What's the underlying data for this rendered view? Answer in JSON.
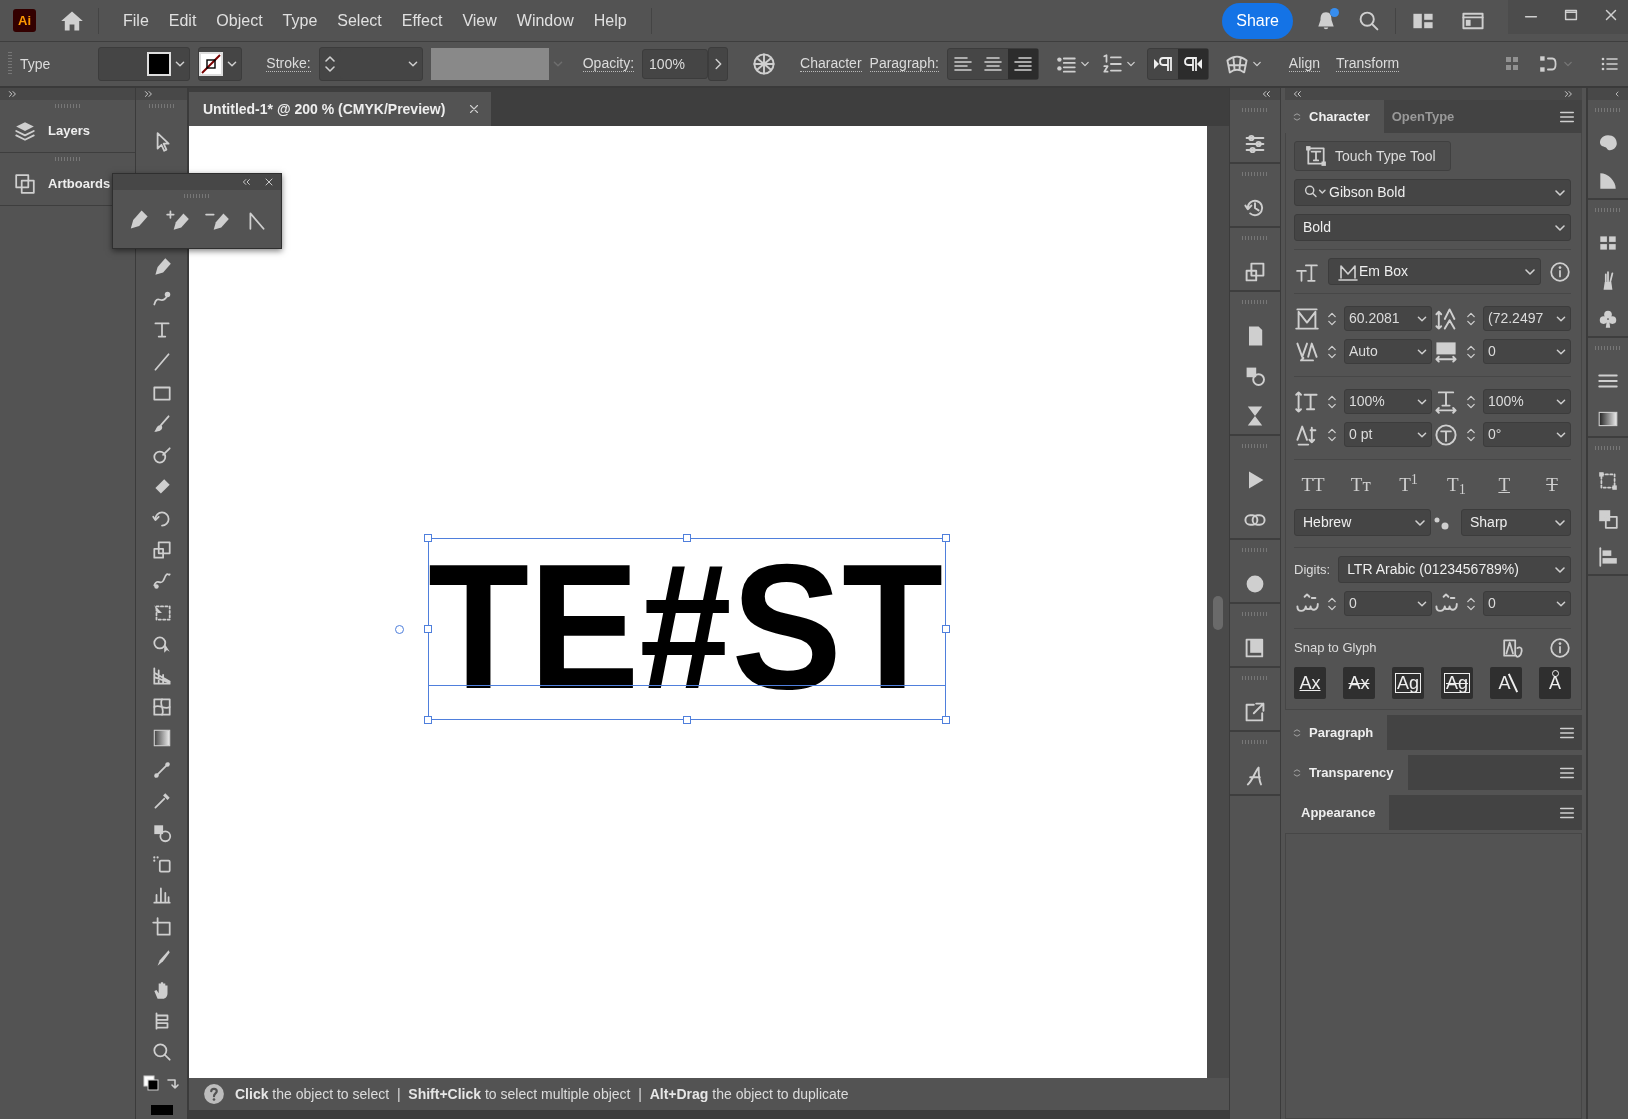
{
  "app": {
    "logo": "Ai"
  },
  "menu": [
    "File",
    "Edit",
    "Object",
    "Type",
    "Select",
    "Effect",
    "View",
    "Window",
    "Help"
  ],
  "share": {
    "label": "Share"
  },
  "notifications": {
    "unread": true
  },
  "control_bar": {
    "tool": "Type",
    "stroke_label": "Stroke:",
    "opacity_label": "Opacity:",
    "opacity": "100%",
    "links": [
      "Character",
      "Paragraph:"
    ],
    "alignment": [
      {
        "kind": "left",
        "selected": false
      },
      {
        "kind": "center",
        "selected": false
      },
      {
        "kind": "right",
        "selected": true
      }
    ],
    "direction": [
      {
        "kind": "ltr",
        "selected": false
      },
      {
        "kind": "rtl",
        "selected": true
      }
    ],
    "panels": [
      "Align",
      "Transform"
    ]
  },
  "left_dock": {
    "panels": [
      "Layers",
      "Artboards"
    ]
  },
  "document": {
    "tab": "Untitled-1* @ 200 % (CMYK/Preview)",
    "artwork_text": "TE#ST",
    "hint": "**Click** the object to select  |  **Shift+Click** to select multiple object  |  **Alt+Drag** the object to duplicate"
  },
  "character_panel": {
    "tabs": [
      {
        "label": "Character",
        "selected": true
      },
      {
        "label": "OpenType",
        "selected": false
      }
    ],
    "touch_type": "Touch Type Tool",
    "font_family": "Gibson Bold",
    "font_style": "Bold",
    "em_box": "Em Box",
    "metrics": [
      "60.2081",
      "(72.2497",
      "Auto",
      "0",
      "100%",
      "100%",
      "0 pt",
      "0°"
    ],
    "type_styles": [
      {
        "label": "TT",
        "kind": "caps"
      },
      {
        "label": "Tᴛ",
        "kind": "smallcaps"
      },
      {
        "label": "T$^{1}$",
        "kind": "super"
      },
      {
        "label": "T$_{1}$",
        "kind": "sub"
      },
      {
        "label": "T",
        "kind": "underline"
      },
      {
        "label": "T",
        "kind": "strike"
      }
    ],
    "language": "Hebrew",
    "anti_alias": "Sharp",
    "digits_label": "Digits:",
    "digits": "LTR Arabic (0123456789%)",
    "arabic_fields": [
      "0",
      "0"
    ],
    "snap_label": "Snap to Glyph",
    "snap_options": [
      {
        "label": "Ax",
        "kind": "underline"
      },
      {
        "label": "Ax",
        "kind": "strike"
      },
      {
        "label": "Ag",
        "kind": "box"
      },
      {
        "label": "Ag",
        "kind": "box-strike"
      },
      {
        "label": "A",
        "kind": "slash"
      },
      {
        "label": "A",
        "kind": "ring"
      }
    ]
  },
  "collapsed_panels": [
    {
      "label": "Paragraph",
      "expander": true
    },
    {
      "label": "Transparency",
      "expander": true
    },
    {
      "label": "Appearance",
      "expander": false
    }
  ]
}
